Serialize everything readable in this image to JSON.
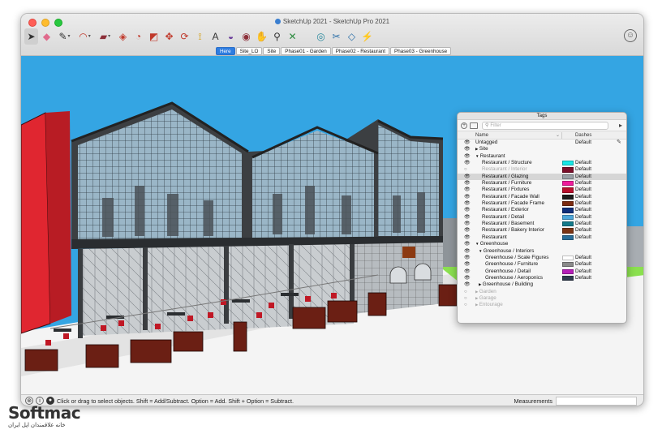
{
  "window": {
    "title": "SketchUp 2021 - SketchUp Pro 2021"
  },
  "toolbar": {
    "tools": [
      {
        "icon": "select-arrow-icon",
        "glyph": "➤",
        "color": "#333333",
        "active": true
      },
      {
        "icon": "eraser-icon",
        "glyph": "◆",
        "color": "#e06a8c"
      },
      {
        "icon": "pencil-line-icon",
        "glyph": "✎",
        "color": "#333333",
        "drop": true
      },
      {
        "icon": "arc-icon",
        "glyph": "◠",
        "color": "#c0392b",
        "drop": true
      },
      {
        "icon": "rectangle-icon",
        "glyph": "▰",
        "color": "#8c2f39",
        "drop": true
      },
      {
        "icon": "push-pull-icon",
        "glyph": "◈",
        "color": "#c0392b"
      },
      {
        "icon": "offset-icon",
        "glyph": "◔",
        "color": "#c0392b"
      },
      {
        "icon": "scale-icon",
        "glyph": "◩",
        "color": "#c0392b"
      },
      {
        "icon": "move-icon",
        "glyph": "✥",
        "color": "#c0392b"
      },
      {
        "icon": "rotate-icon",
        "glyph": "⟳",
        "color": "#c0392b"
      },
      {
        "icon": "tape-measure-icon",
        "glyph": "⟟",
        "color": "#d4a017"
      },
      {
        "icon": "text-icon",
        "glyph": "A",
        "color": "#333333"
      },
      {
        "icon": "paint-bucket-icon",
        "glyph": "◒",
        "color": "#6a3d9a"
      },
      {
        "icon": "orbit-icon",
        "glyph": "◉",
        "color": "#8c2f39"
      },
      {
        "icon": "pan-icon",
        "glyph": "✋",
        "color": "#d4a017"
      },
      {
        "icon": "zoom-icon",
        "glyph": "⚲",
        "color": "#333333"
      },
      {
        "icon": "zoom-extents-icon",
        "glyph": "✕",
        "color": "#2b8a3e"
      },
      {
        "gap": true
      },
      {
        "icon": "extension-warehouse-icon",
        "glyph": "◎",
        "color": "#2b8a9e"
      },
      {
        "icon": "3d-warehouse-icon",
        "glyph": "✂",
        "color": "#2b6fa8"
      },
      {
        "icon": "layout-icon",
        "glyph": "◇",
        "color": "#2b6fa8"
      },
      {
        "icon": "style-builder-icon",
        "glyph": "⚡",
        "color": "#2b6fa8"
      }
    ]
  },
  "scenes": [
    "Here",
    "Site_LO",
    "Site",
    "Phase01 - Garden",
    "Phase02 - Restaurant",
    "Phase03 - Greenhouse"
  ],
  "selected_scene": "Here",
  "tags_panel": {
    "title": "Tags",
    "search_placeholder": "Filter",
    "col_name": "Name",
    "col_dashes": "Dashes",
    "rows": [
      {
        "name": "Untagged",
        "indent": 0,
        "dash": "Default",
        "pencil": true
      },
      {
        "name": "Site",
        "indent": 0,
        "arrow": "▶"
      },
      {
        "name": "Restaurant",
        "indent": 0,
        "arrow": "▼"
      },
      {
        "name": "Restaurant / Structure",
        "indent": 2,
        "color": "#19e6e6",
        "dash": "Default"
      },
      {
        "name": "Restaurant / Interior",
        "indent": 2,
        "color": "#7a0f2a",
        "dash": "Default",
        "dim": true,
        "hidden": true
      },
      {
        "name": "Restaurant / Glazing",
        "indent": 2,
        "color": "#9aa0a6",
        "dash": "Default",
        "highlight": true
      },
      {
        "name": "Restaurant / Furniture",
        "indent": 2,
        "color": "#ef1b9b",
        "dash": "Default"
      },
      {
        "name": "Restaurant / Fixtures",
        "indent": 2,
        "color": "#b80f2d",
        "dash": "Default"
      },
      {
        "name": "Restaurant / Facade Wall",
        "indent": 2,
        "color": "#1e1e1e",
        "dash": "Default"
      },
      {
        "name": "Restaurant / Facade Frame",
        "indent": 2,
        "color": "#7b2a10",
        "dash": "Default"
      },
      {
        "name": "Restaurant / Exterior",
        "indent": 2,
        "color": "#0f2f7a",
        "dash": "Default"
      },
      {
        "name": "Restaurant / Detail",
        "indent": 2,
        "color": "#4da6d9",
        "dash": "Default"
      },
      {
        "name": "Restaurant / Basement",
        "indent": 2,
        "color": "#157a8a",
        "dash": "Default"
      },
      {
        "name": "Restaurant / Bakery Interior",
        "indent": 2,
        "color": "#7a3414",
        "dash": "Default"
      },
      {
        "name": "Restaurant",
        "indent": 2,
        "color": "#2a6e99",
        "dash": "Default"
      },
      {
        "name": "Greenhouse",
        "indent": 0,
        "arrow": "▼"
      },
      {
        "name": "Greenhouse / Interiors",
        "indent": 1,
        "arrow": "▼"
      },
      {
        "name": "Greenhouse / Scale Figures",
        "indent": 3,
        "color": "#ffffff",
        "dash": "Default"
      },
      {
        "name": "Greenhouse / Furniture",
        "indent": 3,
        "color": "#8a8a8a",
        "dash": "Default"
      },
      {
        "name": "Greenhouse / Detail",
        "indent": 3,
        "color": "#b51fb8",
        "dash": "Default"
      },
      {
        "name": "Greenhouse / Aeroponics",
        "indent": 3,
        "color": "#2f3b4e",
        "dash": "Default"
      },
      {
        "name": "Greenhouse / Building",
        "indent": 1,
        "arrow": "▶"
      },
      {
        "name": "Garden",
        "indent": 0,
        "arrow": "▶",
        "dim": true,
        "hidden": true
      },
      {
        "name": "Garage",
        "indent": 0,
        "arrow": "▶",
        "dim": true,
        "hidden": true
      },
      {
        "name": "Entourage",
        "indent": 0,
        "arrow": "▶",
        "dim": true,
        "hidden": true
      }
    ]
  },
  "status": {
    "hint": "Click or drag to select objects. Shift = Add/Subtract. Option = Add. Shift + Option = Subtract.",
    "measurements_label": "Measurements"
  },
  "watermark": {
    "brand": "Softmac",
    "subtitle": "خانه علاقمندان اپل ایران"
  },
  "colors": {
    "sky": "#34a5e3",
    "selected_scene": "#2e7de1",
    "building_red": "#e02630",
    "furniture": "#6b1f14"
  }
}
